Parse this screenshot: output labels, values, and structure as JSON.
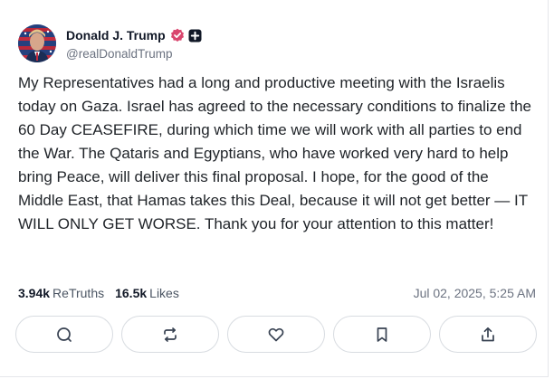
{
  "post": {
    "author": {
      "display_name": "Donald J. Trump",
      "handle": "@realDonaldTrump",
      "avatar": "flag-portrait-avatar",
      "verified_icon": "verified-badge-icon",
      "plus_icon": "plus-badge-icon"
    },
    "text": "My Representatives had a long and productive meeting with the Israelis today on Gaza. Israel has agreed to the necessary conditions to finalize the 60 Day CEASEFIRE, during which time we will work with all parties to end the War. The Qataris and Egyptians, who have worked very hard to help bring Peace, will deliver this final proposal. I hope, for the good of the Middle East, that Hamas takes this Deal, because it will not get better — IT WILL ONLY GET WORSE. Thank you for your attention to this matter!",
    "stats": {
      "retruths_count": "3.94k",
      "retruths_label": "ReTruths",
      "likes_count": "16.5k",
      "likes_label": "Likes"
    },
    "timestamp": "Jul 02, 2025, 5:25 AM",
    "actions": [
      "reply-icon",
      "retruth-icon",
      "like-icon",
      "bookmark-icon",
      "share-icon"
    ]
  },
  "colors": {
    "verified": "#d9466e",
    "text": "#1f2328",
    "muted": "#6b7280",
    "button_border": "#d8dce1"
  }
}
